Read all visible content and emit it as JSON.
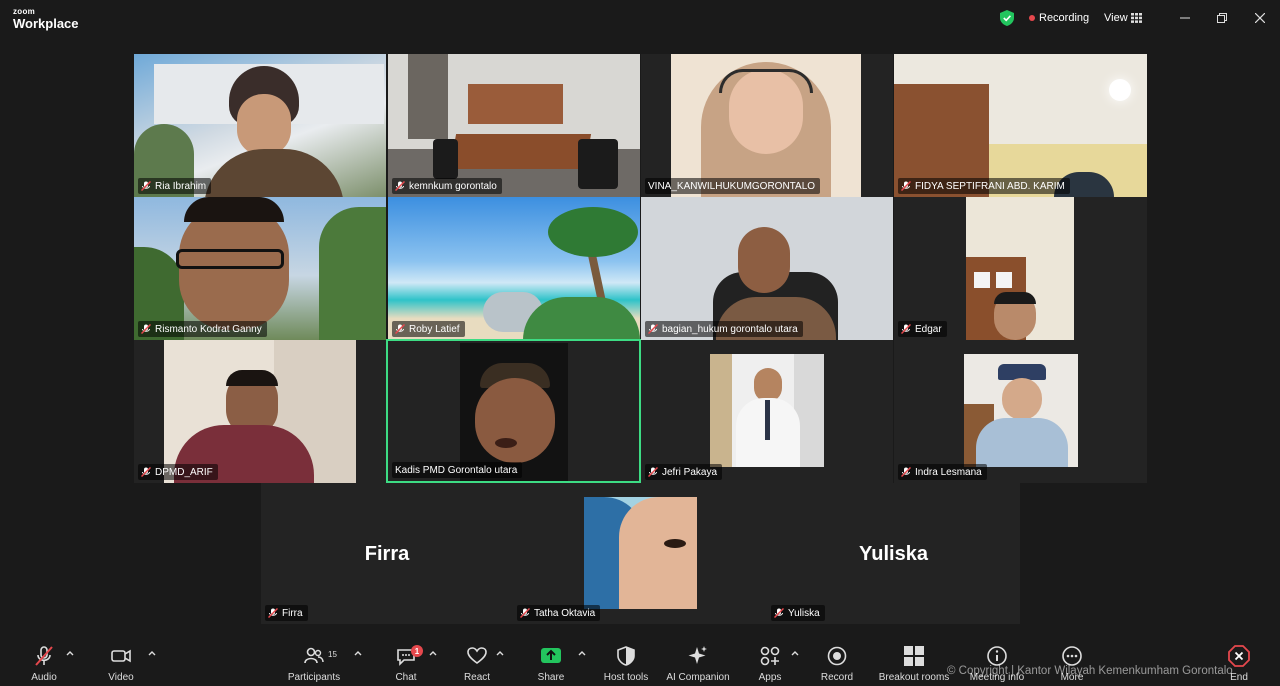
{
  "app": {
    "brand_top": "zoom",
    "brand_bottom": "Workplace",
    "recording_label": "Recording",
    "view_label": "View"
  },
  "participants_grid": [
    {
      "name": "Ria Ibrahim"
    },
    {
      "name": "kemnkum gorontalo"
    },
    {
      "name": "VINA_KANWILHUKUMGORONTALO"
    },
    {
      "name": "FIDYA SEPTIFRANI ABD. KARIM"
    },
    {
      "name": "Rismanto Kodrat Ganny"
    },
    {
      "name": "Roby Latief"
    },
    {
      "name": "bagian_hukum gorontalo utara"
    },
    {
      "name": "Edgar"
    },
    {
      "name": "DPMD_ARIF"
    },
    {
      "name": "Kadis PMD Gorontalo utara"
    },
    {
      "name": "Jefri Pakaya"
    },
    {
      "name": "Indra Lesmana"
    },
    {
      "name": "Firra",
      "avatar_text": "Firra"
    },
    {
      "name": "Tatha Oktavia"
    },
    {
      "name": "Yuliska",
      "avatar_text": "Yuliska"
    }
  ],
  "toolbar": {
    "audio": "Audio",
    "video": "Video",
    "participants": "Participants",
    "participants_count": "15",
    "chat": "Chat",
    "chat_badge": "1",
    "react": "React",
    "share": "Share",
    "host_tools": "Host tools",
    "ai_companion": "AI Companion",
    "apps": "Apps",
    "record": "Record",
    "breakout_rooms": "Breakout rooms",
    "meeting_info": "Meeting info",
    "more": "More",
    "end": "End"
  },
  "watermark": "© Copyright | Kantor Wilayah Kemenkumham Gorontalo",
  "colors": {
    "background": "#1a1a1a",
    "active_speaker": "#3ddc84",
    "recording": "#e5484d",
    "share": "#23c55e",
    "shield": "#22c55e"
  }
}
